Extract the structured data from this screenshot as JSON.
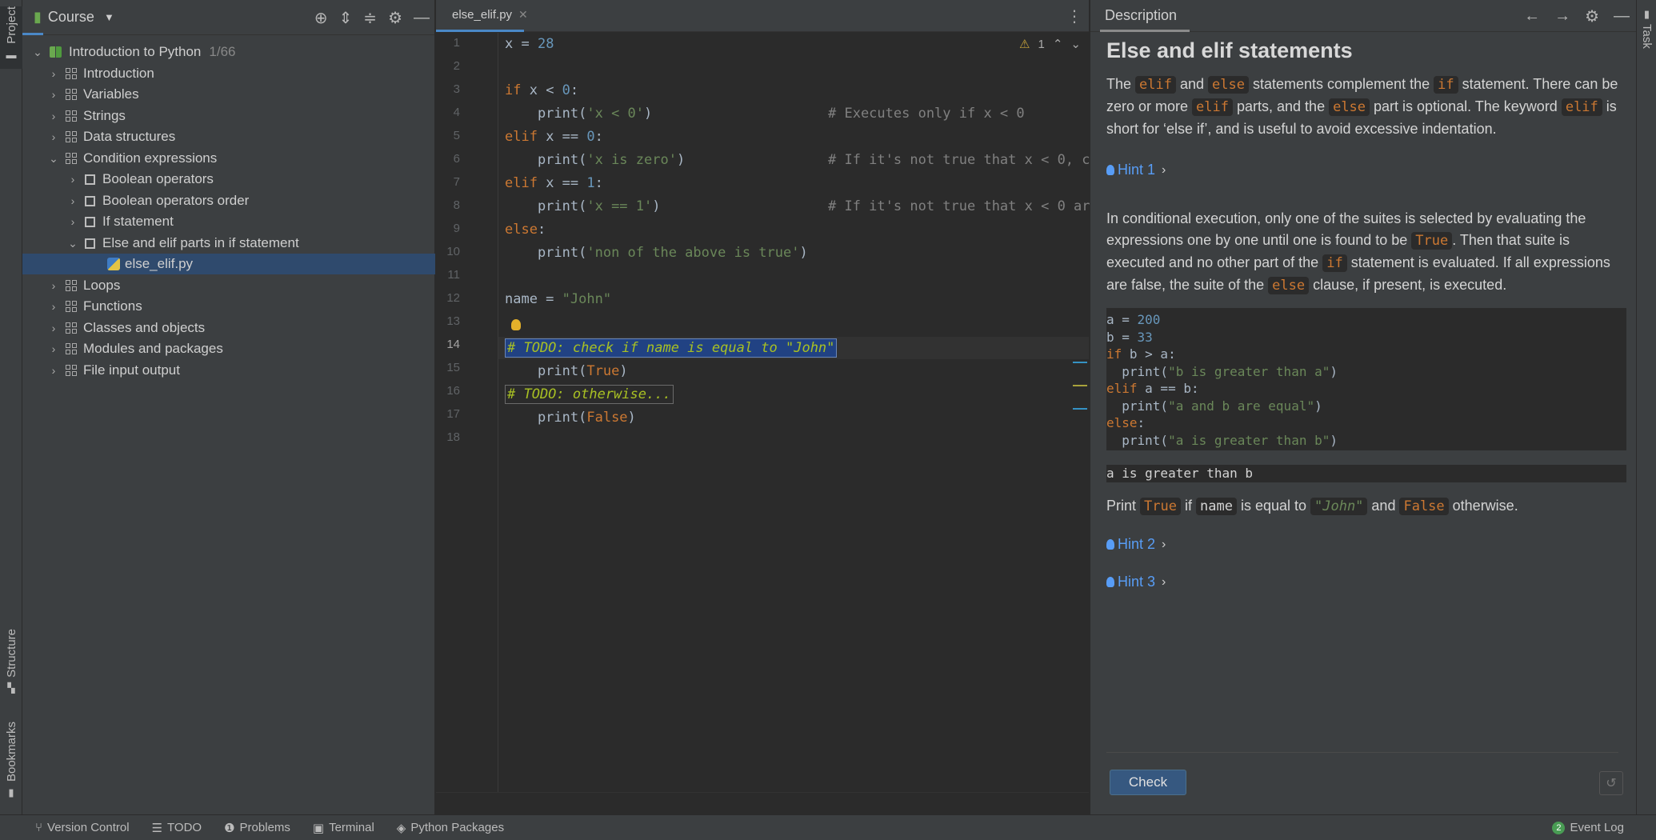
{
  "side_tabs": {
    "project": "Project",
    "structure": "Structure",
    "bookmarks": "Bookmarks",
    "task": "Task"
  },
  "project_panel": {
    "title": "Course",
    "root": {
      "label": "Introduction to Python",
      "progress": "1/66"
    },
    "items": [
      {
        "label": "Introduction"
      },
      {
        "label": "Variables"
      },
      {
        "label": "Strings"
      },
      {
        "label": "Data structures"
      },
      {
        "label": "Condition expressions"
      },
      {
        "label": "Boolean operators"
      },
      {
        "label": "Boolean operators order"
      },
      {
        "label": "If statement"
      },
      {
        "label": "Else and elif parts in if statement"
      },
      {
        "label": "else_elif.py"
      },
      {
        "label": "Loops"
      },
      {
        "label": "Functions"
      },
      {
        "label": "Classes and objects"
      },
      {
        "label": "Modules and packages"
      },
      {
        "label": "File input output"
      }
    ]
  },
  "editor": {
    "tab_label": "else_elif.py",
    "warnings": "1",
    "line_numbers": [
      "1",
      "2",
      "3",
      "4",
      "5",
      "6",
      "7",
      "8",
      "9",
      "10",
      "11",
      "12",
      "13",
      "14",
      "15",
      "16",
      "17",
      "18"
    ],
    "code": {
      "l1_a": "x = ",
      "l1_b": "28",
      "l3_a": "if",
      "l3_b": " x < ",
      "l3_c": "0",
      "l3_d": ":",
      "l4_a": "    print(",
      "l4_b": "'x < 0'",
      "l4_c": ")",
      "l4_d": "# Executes only if x < 0",
      "l5_a": "elif",
      "l5_b": " x == ",
      "l5_c": "0",
      "l5_d": ":",
      "l6_a": "    print(",
      "l6_b": "'x is zero'",
      "l6_c": ")",
      "l6_d": "# If it's not true that x < 0, c",
      "l7_a": "elif",
      "l7_b": " x == ",
      "l7_c": "1",
      "l7_d": ":",
      "l8_a": "    print(",
      "l8_b": "'x == 1'",
      "l8_c": ")",
      "l8_d": "# If it's not true that x < 0 ar",
      "l9_a": "else",
      "l9_b": ":",
      "l10_a": "    print(",
      "l10_b": "'non of the above is true'",
      "l10_c": ")",
      "l12_a": "name = ",
      "l12_b": "\"John\"",
      "l14": "# TODO: check if name is equal to \"John\"",
      "l15_a": "    print(",
      "l15_b": "True",
      "l15_c": ")",
      "l16": "# TODO: otherwise...",
      "l17_a": "    print(",
      "l17_b": "False",
      "l17_c": ")"
    }
  },
  "description": {
    "tab": "Description",
    "title": "Else and elif statements",
    "p1": {
      "t1": "The ",
      "c1": "elif",
      "t2": " and ",
      "c2": "else",
      "t3": " statements complement the ",
      "c3": "if",
      "t4": " statement. There can be zero or more ",
      "c4": "elif",
      "t5": " parts, and the ",
      "c5": "else",
      "t6": " part is optional. The keyword ",
      "c6": "elif",
      "t7": " is short for ‘else if’, and is useful to avoid excessive indentation."
    },
    "hint1": "Hint 1",
    "p2": {
      "t1": "In conditional execution, only one of the suites is selected by evaluating the expressions one by one until one is found to be ",
      "c1": "True",
      "t2": ". Then that suite is executed and no other part of the ",
      "c2": "if",
      "t3": " statement is evaluated. If all expressions are false, the suite of the ",
      "c3": "else",
      "t4": " clause, if present, is executed."
    },
    "example": {
      "l1_a": "a = ",
      "l1_b": "200",
      "l2_a": "b = ",
      "l2_b": "33",
      "l3_a": "if",
      "l3_b": " b > a:",
      "l4_a": "  print(",
      "l4_b": "\"b is greater than a\"",
      "l4_c": ")",
      "l5_a": "elif",
      "l5_b": " a == b:",
      "l6_a": "  print(",
      "l6_b": "\"a and b are equal\"",
      "l6_c": ")",
      "l7_a": "else",
      "l7_b": ":",
      "l8_a": "  print(",
      "l8_b": "\"a is greater than b\"",
      "l8_c": ")"
    },
    "output": "a is greater than b",
    "task": {
      "t1": "Print ",
      "c1": "True",
      "t2": " if ",
      "c2": "name",
      "t3": " is equal to ",
      "c3": "\"John\"",
      "t4": " and ",
      "c4": "False",
      "t5": " otherwise."
    },
    "hint2": "Hint 2",
    "hint3": "Hint 3",
    "check_label": "Check"
  },
  "statusbar": {
    "version_control": "Version Control",
    "todo": "TODO",
    "problems": "Problems",
    "terminal": "Terminal",
    "python_packages": "Python Packages",
    "event_log": "Event Log",
    "event_count": "2"
  }
}
